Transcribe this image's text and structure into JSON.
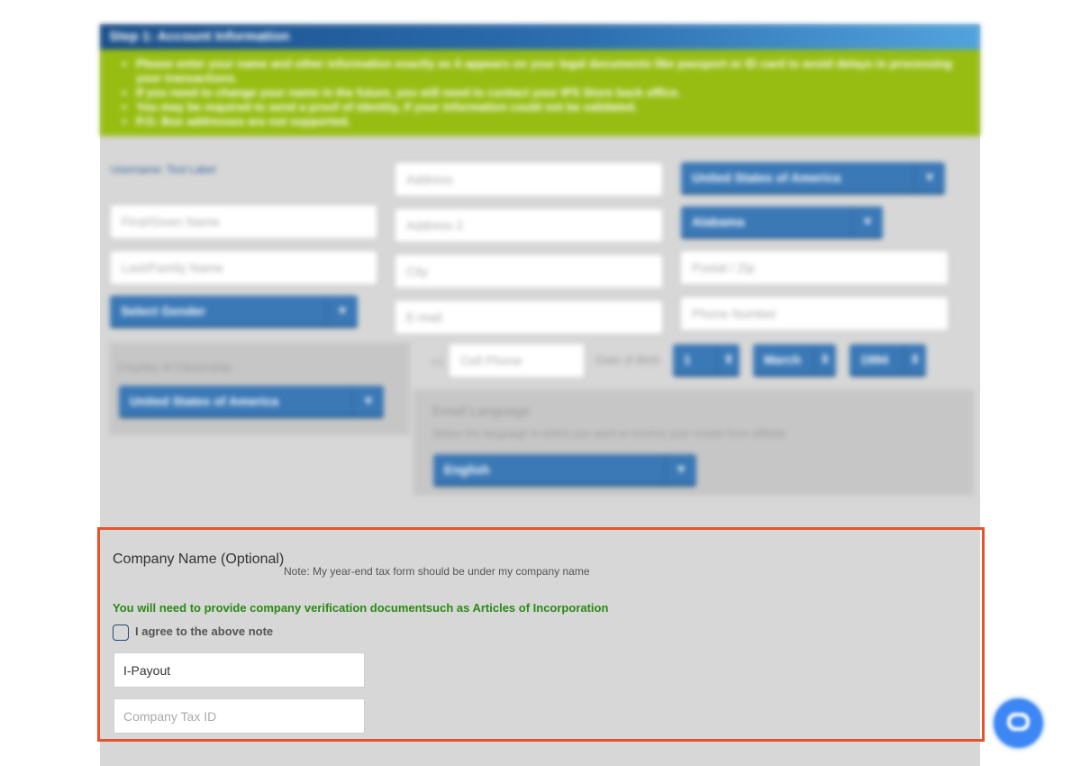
{
  "header": {
    "title": "Step 1: Account Information"
  },
  "notice": {
    "items": [
      "Please enter your name and other information exactly as it appears on your legal documents like passport or ID card to avoid delays in processing your transactions.",
      "If you need to change your name in the future, you will need to contact your IPS Store back office.",
      "You may be required to send a proof of identity, if your information could not be validated.",
      "P.O. Box addresses are not supported."
    ]
  },
  "form": {
    "username_label": "Username: Test Label",
    "first_name_placeholder": "First/Given Name",
    "last_name_placeholder": "Last/Family Name",
    "gender_select": "Select Gender",
    "address_placeholder": "Address",
    "address2_placeholder": "Address 2",
    "city_placeholder": "City",
    "email_placeholder": "E-mail",
    "country_select": "United States of America",
    "state_select": "Alabama",
    "postal_placeholder": "Postal / Zip",
    "phone_placeholder": "Phone Number",
    "citizenship_label": "Country of Citizenship",
    "citizenship_select": "United States of America",
    "cell_prefix": "+1",
    "cell_placeholder": "Cell Phone",
    "dob_label": "Date of Birth",
    "dob_day": "1",
    "dob_month": "March",
    "dob_year": "1994",
    "email_language_title": "Email Language",
    "email_language_desc": "Select the language in which you want to receive your emails from affiliate",
    "language_select": "English"
  },
  "company": {
    "title": "Company Name (Optional)",
    "note": "Note: My year-end tax form should be under my company name",
    "verification": "You will need to provide company verification documentsuch as Articles of Incorporation",
    "agree_label": "I agree to the above note",
    "name_value": "I-Payout",
    "tax_id_placeholder": "Company Tax ID"
  },
  "colors": {
    "highlight_border": "#e8522a",
    "verification_text": "#2a8a14",
    "select_blue": "#3a78b6",
    "notice_green": "#97bd13"
  },
  "icons": {
    "chat": "chat-bubble-icon",
    "dropdown": "chevron-down-icon"
  }
}
